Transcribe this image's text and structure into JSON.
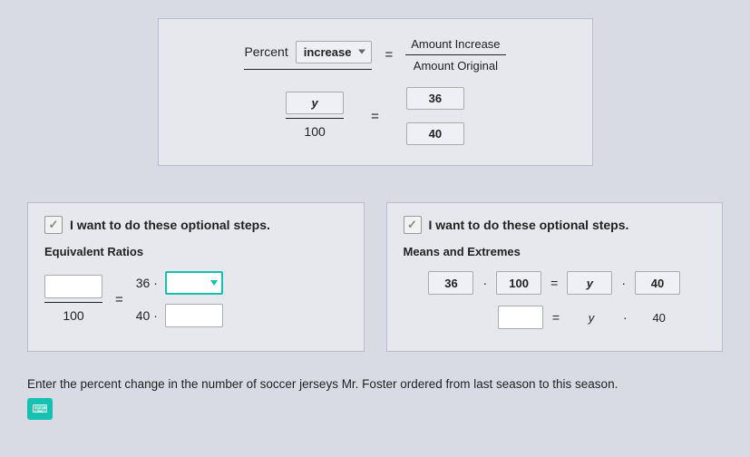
{
  "top": {
    "percent_label": "Percent",
    "change_type": "increase",
    "rhs_top": "Amount Increase",
    "rhs_bot": "Amount Original",
    "lhs_var": "y",
    "lhs_denom": "100",
    "numer_value": "36",
    "denom_value": "40"
  },
  "panels": {
    "opt_label": "I want to do these optional steps.",
    "left": {
      "title": "Equivalent Ratios",
      "denom": "100",
      "eq": "=",
      "r_top_prefix": "36 ·",
      "r_bot_prefix": "40 ·"
    },
    "right": {
      "title": "Means and Extremes",
      "row1": {
        "a": "36",
        "dot": "·",
        "b": "100",
        "eq": "=",
        "c": "y",
        "d": "40"
      },
      "row2": {
        "eq": "=",
        "c": "y",
        "dot": "·",
        "d": "40"
      }
    }
  },
  "question": "Enter the percent change in the number of soccer jerseys Mr. Foster ordered from last season to this season.",
  "checkmark": "✓",
  "calc_icon": "⌨"
}
